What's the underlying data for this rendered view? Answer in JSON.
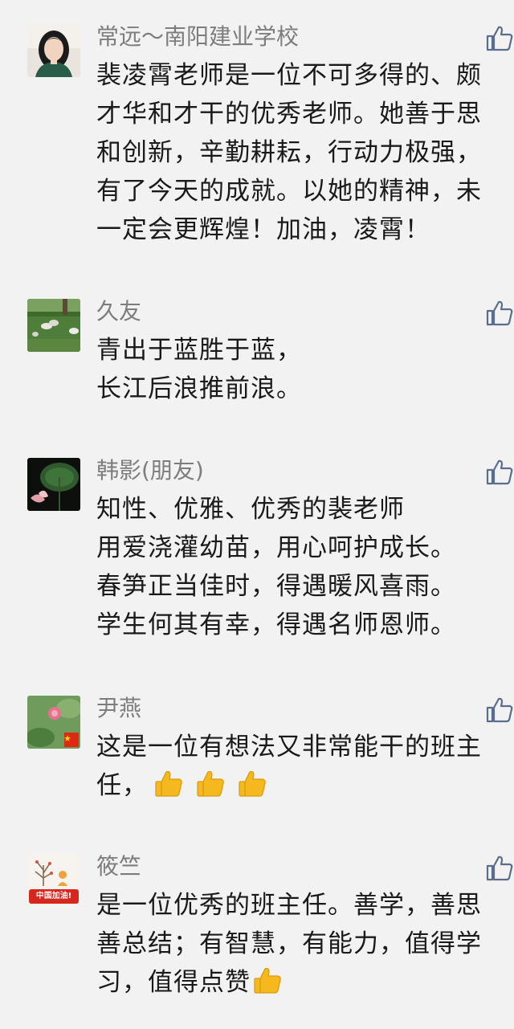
{
  "comments": [
    {
      "author": "常远～南阳建业学校",
      "avatar_icon": "woman-portrait-avatar",
      "lines": [
        "裴凌霄老师是一位不可多得的、颇",
        "才华和才干的优秀老师。她善于思",
        "和创新，辛勤耕耘，行动力极强，",
        "有了今天的成就。以她的精神，未",
        "一定会更辉煌！加油，凌霄！"
      ]
    },
    {
      "author": "久友",
      "avatar_icon": "sheep-on-grass-avatar",
      "lines": [
        "青出于蓝胜于蓝，",
        "长江后浪推前浪。"
      ]
    },
    {
      "author": "韩影(朋友)",
      "avatar_icon": "lotus-leaf-dark-avatar",
      "lines": [
        "知性、优雅、优秀的裴老师",
        "用爱浇灌幼苗，用心呵护成长。",
        "春笋正当佳时，得遇暖风喜雨。",
        "学生何其有幸，得遇名师恩师。"
      ]
    },
    {
      "author": "尹燕",
      "avatar_icon": "lotus-flower-flag-avatar",
      "lines": [
        "这是一位有想法又非常能干的班主",
        "任，"
      ],
      "trailing_emoji": "thumbs-up-emoji",
      "trailing_emoji_count": 3
    },
    {
      "author": "筱竺",
      "avatar_icon": "china-jiayou-avatar",
      "avatar_text": "中国加油!",
      "lines": [
        "是一位优秀的班主任。善学，善思",
        "善总结；有智慧，有能力，值得学",
        "习，值得点赞"
      ],
      "trailing_emoji": "thumbs-up-emoji",
      "trailing_emoji_count": 1
    }
  ],
  "like_icon": "thumbs-up-outline-icon",
  "colors": {
    "background": "#f2f2f2",
    "author": "#7d7d7d",
    "text": "#1a1a1a",
    "like_outline": "#5a6d8c",
    "emoji": "#f5b91f"
  }
}
